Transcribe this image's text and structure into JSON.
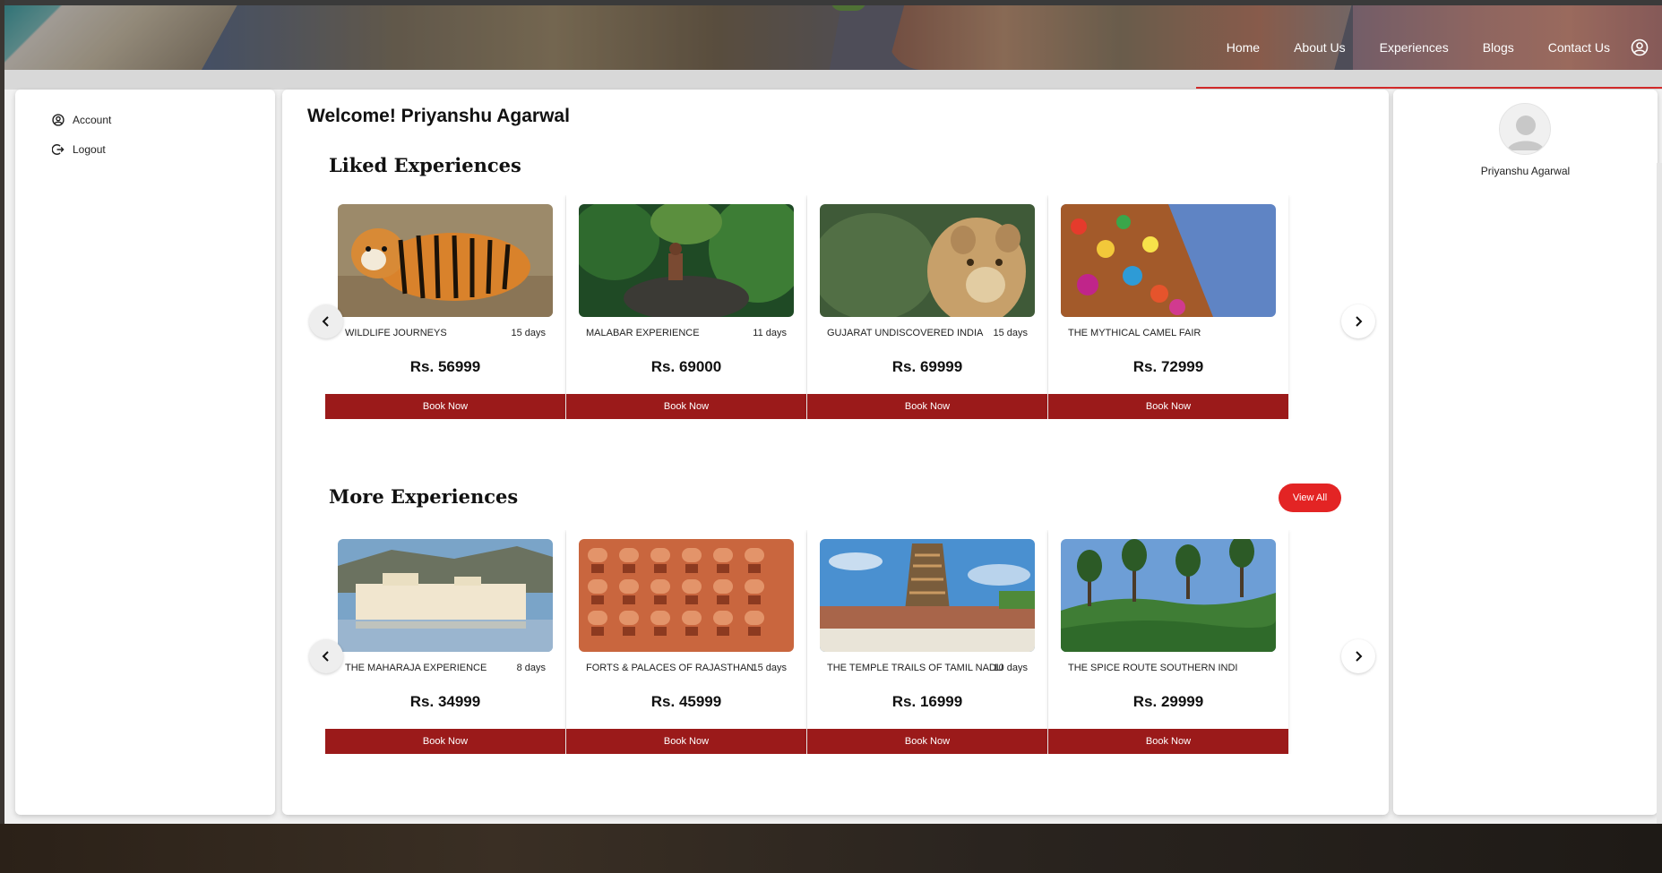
{
  "nav": {
    "items": [
      "Home",
      "About Us",
      "Experiences",
      "Blogs",
      "Contact Us"
    ],
    "user_icon": "user-circle-icon"
  },
  "sidebar": {
    "items": [
      {
        "label": "Account",
        "icon": "user-circle-icon"
      },
      {
        "label": "Logout",
        "icon": "logout-icon"
      }
    ]
  },
  "main": {
    "welcome": "Welcome! Priyanshu Agarwal",
    "liked": {
      "title": "Liked Experiences",
      "cards": [
        {
          "name": "WILDLIFE JOURNEYS",
          "days": "15 days",
          "price": "Rs. 56999",
          "button": "Book Now",
          "image": "tiger"
        },
        {
          "name": "MALABAR EXPERIENCE",
          "days": "11 days",
          "price": "Rs. 69000",
          "button": "Book Now",
          "image": "forest"
        },
        {
          "name": "GUJARAT UNDISCOVERED INDIA",
          "days": "15 days",
          "price": "Rs. 69999",
          "button": "Book Now",
          "image": "lion"
        },
        {
          "name": "THE MYTHICAL CAMEL FAIR",
          "days": "",
          "price": "Rs. 72999",
          "button": "Book Now",
          "image": "camel"
        }
      ]
    },
    "more": {
      "title": "More Experiences",
      "view_all": "View All",
      "cards": [
        {
          "name": "THE MAHARAJA EXPERIENCE",
          "days": "8 days",
          "price": "Rs. 34999",
          "button": "Book Now",
          "image": "lake-palace"
        },
        {
          "name": "FORTS & PALACES OF RAJASTHAN",
          "days": "15 days",
          "price": "Rs. 45999",
          "button": "Book Now",
          "image": "hawa-mahal"
        },
        {
          "name": "THE TEMPLE TRAILS OF TAMIL NADU",
          "days": "10 days",
          "price": "Rs. 16999",
          "button": "Book Now",
          "image": "temple"
        },
        {
          "name": "THE SPICE ROUTE SOUTHERN INDI",
          "days": "",
          "price": "Rs. 29999",
          "button": "Book Now",
          "image": "tea-hills"
        }
      ]
    }
  },
  "profile": {
    "name": "Priyanshu Agarwal"
  },
  "colors": {
    "book_button": "#9b1a1a",
    "view_all": "#e32424"
  }
}
